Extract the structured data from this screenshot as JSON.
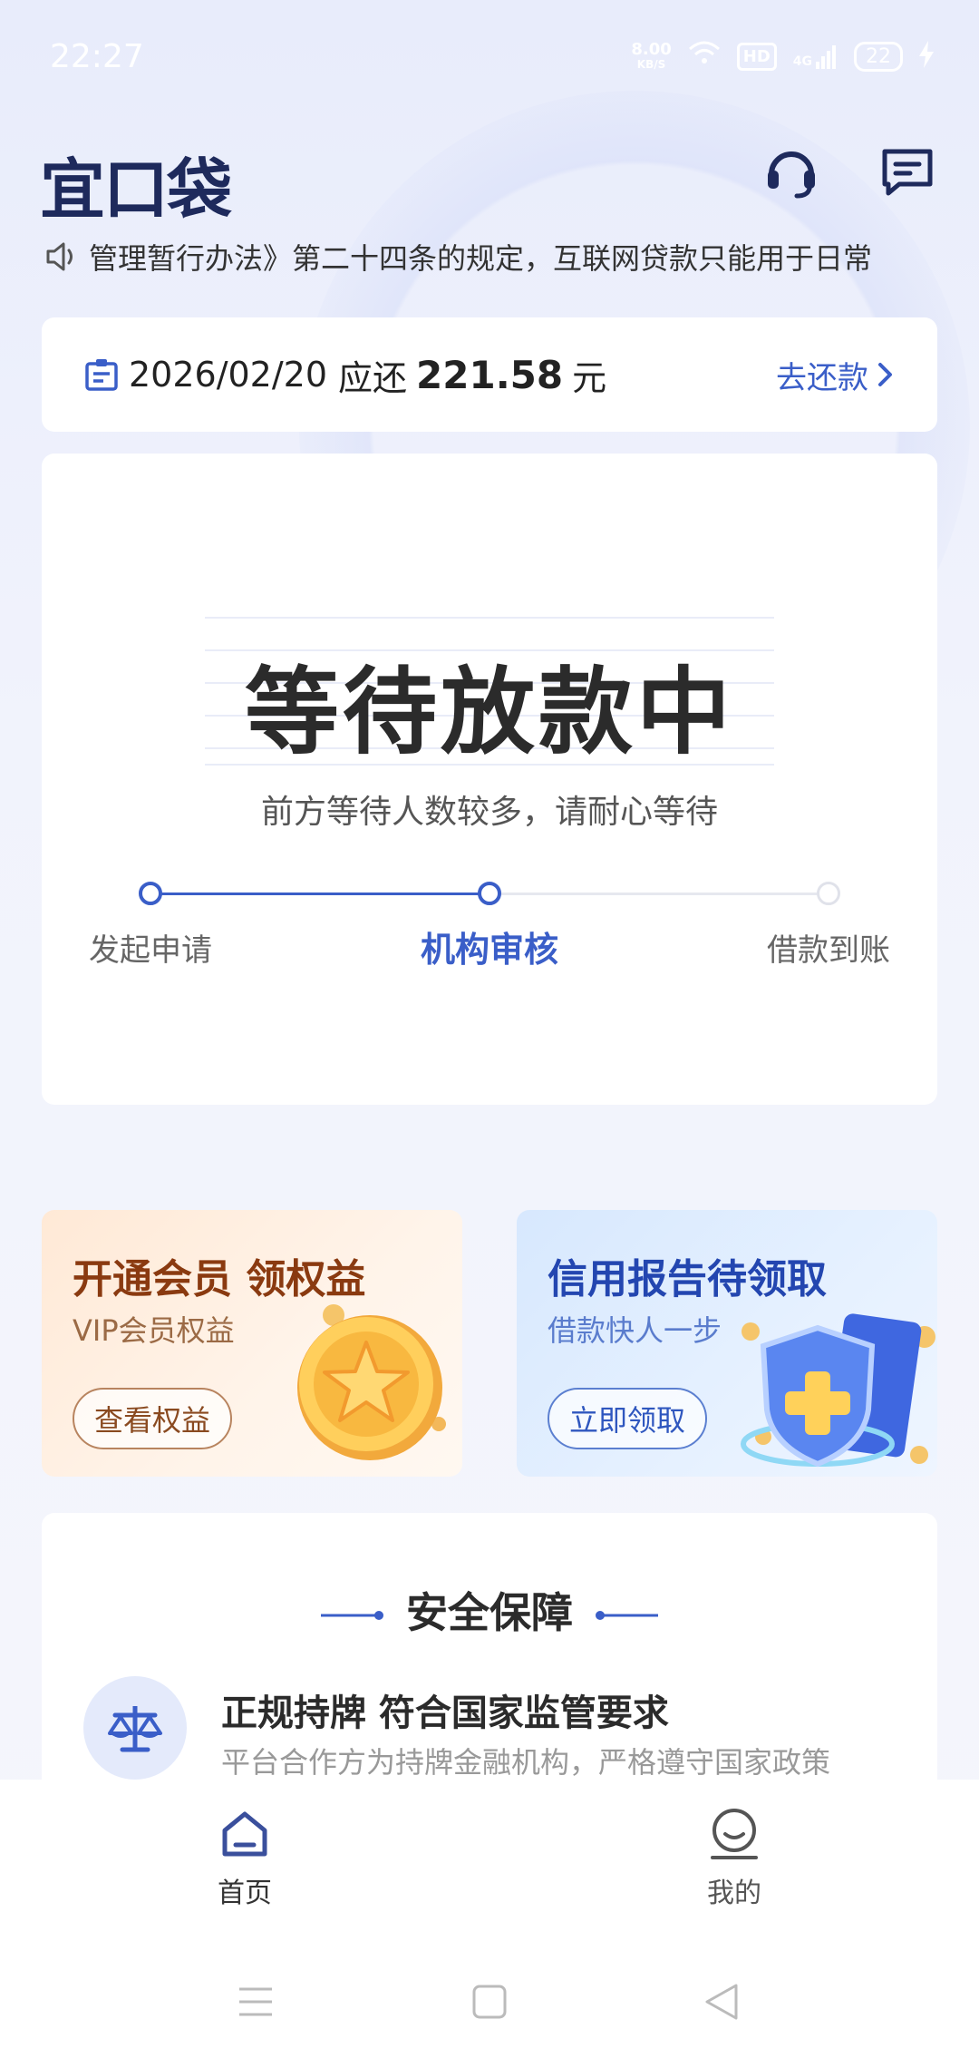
{
  "status_bar": {
    "time": "22:27",
    "net_speed_value": "8.00",
    "net_speed_unit": "KB/S",
    "hd": "HD",
    "network": "4G",
    "battery": "22"
  },
  "header": {
    "logo_text": "宜口袋"
  },
  "notice": {
    "text": "管理暂行办法》第二十四条的规定，互联网贷款只能用于日常"
  },
  "repayment": {
    "date": "2026/02/20",
    "due_label": "应还",
    "amount": "221.58",
    "unit": "元",
    "action_label": "去还款"
  },
  "loan_status": {
    "title": "等待放款中",
    "subtitle": "前方等待人数较多，请耐心等待",
    "steps": [
      {
        "label": "发起申请",
        "state": "done"
      },
      {
        "label": "机构审核",
        "state": "active"
      },
      {
        "label": "借款到账",
        "state": "pending"
      }
    ]
  },
  "promos": {
    "vip": {
      "title": "开通会员 领权益",
      "subtitle": "VIP会员权益",
      "button": "查看权益"
    },
    "credit": {
      "title": "信用报告待领取",
      "subtitle": "借款快人一步",
      "button": "立即领取"
    }
  },
  "security": {
    "title": "安全保障",
    "item_title": "正规持牌 符合国家监管要求",
    "item_desc": "平台合作方为持牌金融机构，严格遵守国家政策"
  },
  "bottom_nav": {
    "home": "首页",
    "mine": "我的"
  },
  "colors": {
    "accent": "#3a5ec8",
    "logo": "#1e2a5c"
  }
}
